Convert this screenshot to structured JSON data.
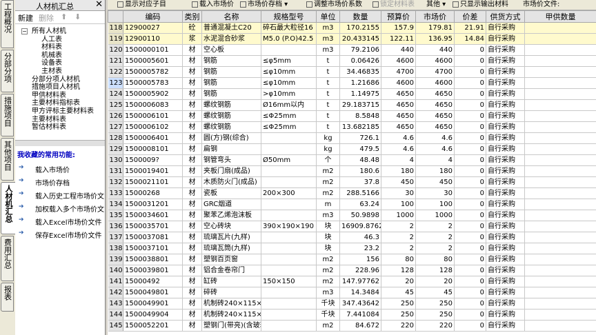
{
  "vertical_tabs": [
    {
      "label": "工程概况"
    },
    {
      "label": "分部分项"
    },
    {
      "label": "措施项目"
    },
    {
      "label": "其他项目"
    },
    {
      "label": "人材机汇总"
    },
    {
      "label": "费用汇总"
    },
    {
      "label": "报表"
    }
  ],
  "left_panel": {
    "title": "人材机汇总",
    "close": "✕",
    "toolbar": {
      "new": "新建",
      "delete": "删除",
      "up": "⬆",
      "down": "⬇"
    },
    "tree": [
      {
        "label": "所有人材机"
      },
      {
        "label": "人工表"
      },
      {
        "label": "材料表"
      },
      {
        "label": "机械表"
      },
      {
        "label": "设备表"
      },
      {
        "label": "主材表"
      },
      {
        "label": "分部分项人材机"
      },
      {
        "label": "措施项目人材机"
      },
      {
        "label": "甲供材料表"
      },
      {
        "label": "主要材料指标表"
      },
      {
        "label": "甲方评标主要材料表"
      },
      {
        "label": "主要材料表"
      },
      {
        "label": "暂估材料表"
      }
    ],
    "favorites_title": "我收藏的常用功能:",
    "favorites": [
      {
        "label": "载入市场价"
      },
      {
        "label": "市场价存档"
      },
      {
        "label": "载入历史工程市场价文"
      },
      {
        "label": "加权载入多个市场价文"
      },
      {
        "label": "载入Excel市场价文件"
      },
      {
        "label": "保存Excel市场价文件"
      }
    ]
  },
  "main_toolbar": {
    "show_sub": "显示对应子目",
    "load_price": "载入市场价",
    "save_price": "市场价存档",
    "adjust_factor": "调整市场价系数",
    "lock": "锁定材料表",
    "other": "其他",
    "only_output": "只显示输出材料",
    "price_file": "市场价文件:"
  },
  "table": {
    "headers": [
      "编码",
      "类别",
      "名称",
      "规格型号",
      "单位",
      "数量",
      "预算价",
      "市场价",
      "价差",
      "供货方式",
      "甲供数量"
    ],
    "rows": [
      [
        "118",
        "12900027",
        "砼",
        "普通混凝土C20",
        "碎石最大粒径16",
        "m3",
        "170.2155",
        "157.9",
        "179.81",
        "21.91",
        "自行采购",
        ""
      ],
      [
        "119",
        "12900110",
        "浆",
        "水泥混合砂浆",
        "M5.0 (P.O)42.5",
        "m3",
        "20.433145",
        "122.11",
        "136.95",
        "14.84",
        "自行采购",
        ""
      ],
      [
        "120",
        "1500000101",
        "材",
        "空心板",
        "",
        "m3",
        "79.2106",
        "440",
        "440",
        "0",
        "自行采购",
        ""
      ],
      [
        "121",
        "1500005601",
        "材",
        "钢筋",
        "≤φ5mm",
        "t",
        "0.06426",
        "4600",
        "4600",
        "0",
        "自行采购",
        ""
      ],
      [
        "122",
        "1500005782",
        "材",
        "钢筋",
        "≤φ10mm",
        "t",
        "34.46835",
        "4700",
        "4700",
        "0",
        "自行采购",
        ""
      ],
      [
        "123",
        "1500005783",
        "材",
        "钢筋",
        "≤φ10mm",
        "t",
        "1.21686",
        "4600",
        "4600",
        "0",
        "自行采购",
        ""
      ],
      [
        "124",
        "1500005902",
        "材",
        "钢筋",
        ">φ10mm",
        "t",
        "1.14975",
        "4650",
        "4650",
        "0",
        "自行采购",
        ""
      ],
      [
        "125",
        "1500006083",
        "材",
        "螺纹钢筋",
        "Ø16mm以内",
        "t",
        "29.183715",
        "4650",
        "4650",
        "0",
        "自行采购",
        ""
      ],
      [
        "126",
        "1500006101",
        "材",
        "螺纹钢筋",
        "≤Φ25mm",
        "t",
        "8.5848",
        "4650",
        "4650",
        "0",
        "自行采购",
        ""
      ],
      [
        "127",
        "1500006102",
        "材",
        "螺纹钢筋",
        "≤Φ25mm",
        "t",
        "13.682185",
        "4650",
        "4650",
        "0",
        "自行采购",
        ""
      ],
      [
        "128",
        "1500006401",
        "材",
        "圆(方)钢(综合)",
        "",
        "kg",
        "726.1",
        "4.6",
        "4.6",
        "0",
        "自行采购",
        ""
      ],
      [
        "129",
        "1500008101",
        "材",
        "扁钢",
        "",
        "kg",
        "479.5",
        "4.6",
        "4.6",
        "0",
        "自行采购",
        ""
      ],
      [
        "130",
        "1500009?",
        "材",
        "钢管弯头",
        "Ø50mm",
        "个",
        "48.48",
        "4",
        "4",
        "0",
        "自行采购",
        ""
      ],
      [
        "131",
        "1500019401",
        "材",
        "夹板门扇(成品)",
        "",
        "m2",
        "180.6",
        "180",
        "180",
        "0",
        "自行采购",
        ""
      ],
      [
        "132",
        "1500021101",
        "材",
        "木质防火门(成品)",
        "",
        "m2",
        "37.8",
        "450",
        "450",
        "0",
        "自行采购",
        ""
      ],
      [
        "133",
        "15000268",
        "材",
        "瓷板",
        "200×300",
        "m2",
        "288.5166",
        "30",
        "30",
        "0",
        "自行采购",
        ""
      ],
      [
        "134",
        "1500031201",
        "材",
        "GRC烟道",
        "",
        "m",
        "63.24",
        "100",
        "100",
        "0",
        "自行采购",
        ""
      ],
      [
        "135",
        "1500034601",
        "材",
        "聚苯乙烯泡沫板",
        "",
        "m3",
        "50.9898",
        "1000",
        "1000",
        "0",
        "自行采购",
        ""
      ],
      [
        "136",
        "1500035701",
        "材",
        "空心砖块",
        "390×190×190",
        "块",
        "16909.8762",
        "2",
        "2",
        "0",
        "自行采购",
        ""
      ],
      [
        "137",
        "1500037081",
        "材",
        "琉璃瓦片(九样)",
        "",
        "块",
        "46.3",
        "2",
        "2",
        "0",
        "自行采购",
        ""
      ],
      [
        "138",
        "1500037101",
        "材",
        "琉璃瓦筒(九样)",
        "",
        "块",
        "23.2",
        "2",
        "2",
        "0",
        "自行采购",
        ""
      ],
      [
        "139",
        "1500038801",
        "材",
        "塑钢百页窗",
        "",
        "m2",
        "156",
        "80",
        "80",
        "0",
        "自行采购",
        ""
      ],
      [
        "140",
        "1500039801",
        "材",
        "铝合金卷帘门",
        "",
        "m2",
        "228.96",
        "128",
        "128",
        "0",
        "自行采购",
        ""
      ],
      [
        "141",
        "15000492",
        "材",
        "缸砖",
        "150×150",
        "m2",
        "147.97762",
        "20",
        "20",
        "0",
        "自行采购",
        ""
      ],
      [
        "142",
        "1500049801",
        "材",
        "碎砖",
        "",
        "m3",
        "14.3484",
        "45",
        "45",
        "0",
        "自行采购",
        ""
      ],
      [
        "143",
        "1500049901",
        "材",
        "机制砖240×115×53mm",
        "",
        "千块",
        "347.43642",
        "250",
        "250",
        "0",
        "自行采购",
        ""
      ],
      [
        "144",
        "1500049904",
        "材",
        "机制砖240×115×53mm",
        "",
        "千块",
        "7.441084",
        "250",
        "250",
        "0",
        "自行采购",
        ""
      ],
      [
        "145",
        "1500052201",
        "材",
        "塑钢门(带亮)(含玻璃)",
        "",
        "m2",
        "84.672",
        "220",
        "220",
        "0",
        "自行采购",
        ""
      ]
    ]
  }
}
